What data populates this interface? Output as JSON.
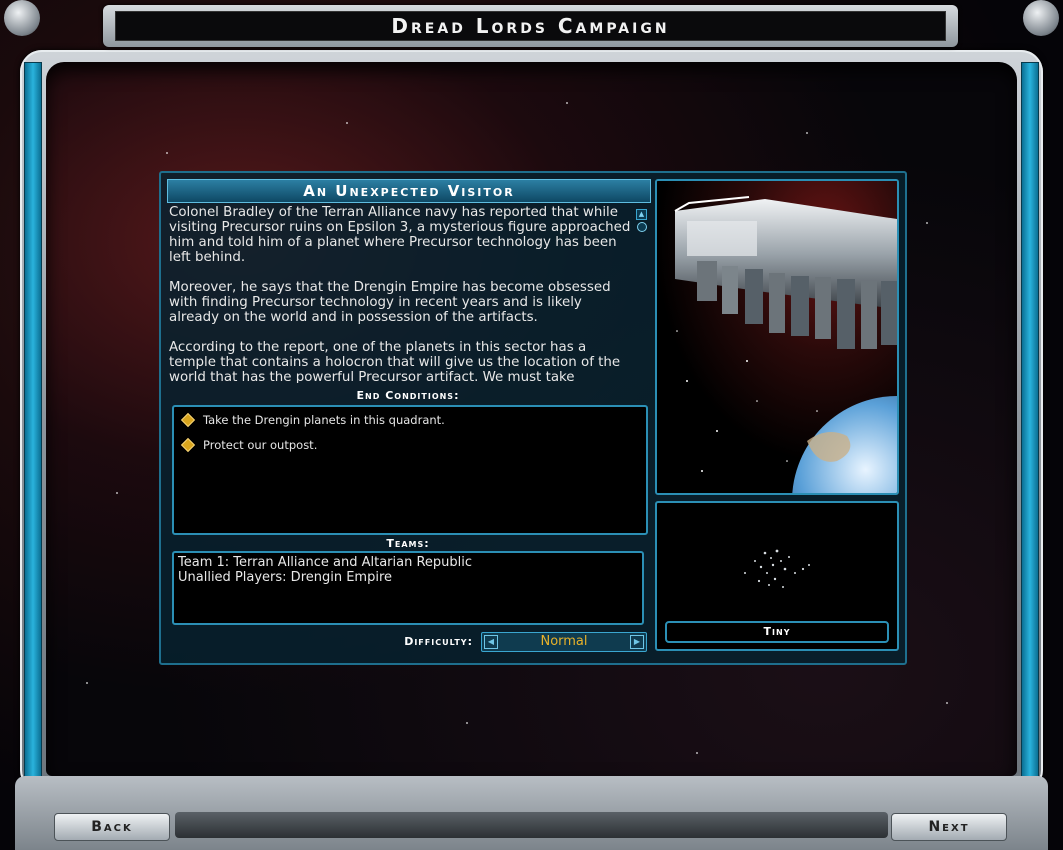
{
  "window": {
    "title": "Dread Lords Campaign"
  },
  "mission": {
    "title": "An Unexpected Visitor",
    "paragraphs": [
      "Colonel Bradley of the Terran Alliance navy has reported that while visiting Precursor ruins on Epsilon 3, a mysterious figure approached him and told him of a planet where Precursor technology has been left behind.",
      "Moreover, he says that the Drengin Empire has become obsessed with finding Precursor technology in recent years and is likely already on the world and in possession of the artifacts.",
      "According to the report, one of the planets in this sector has a temple that contains a holocron that will give us the location of the world that has the powerful Precursor artifact. We must take"
    ]
  },
  "end_conditions": {
    "label": "End Conditions:",
    "items": [
      "Take the Drengin planets in this quadrant.",
      "Protect our outpost."
    ]
  },
  "teams": {
    "label": "Teams:",
    "lines": [
      "Team 1: Terran Alliance and Altarian Republic",
      "Unallied Players: Drengin Empire"
    ]
  },
  "difficulty": {
    "label": "Difficulty:",
    "value": "Normal"
  },
  "map": {
    "size_label": "Tiny"
  },
  "nav": {
    "back_label": "Back",
    "next_label": "Next"
  },
  "icons": {
    "scroll_up": "scroll-up-icon",
    "scroll_thumb": "scroll-thumb-icon",
    "bullet": "diamond-bullet-icon",
    "prev": "arrow-left-icon",
    "next": "arrow-right-icon"
  },
  "colors": {
    "accent": "#2b8fb5",
    "difficulty_text": "#e8b22a",
    "bullet": "#d8a51e"
  }
}
